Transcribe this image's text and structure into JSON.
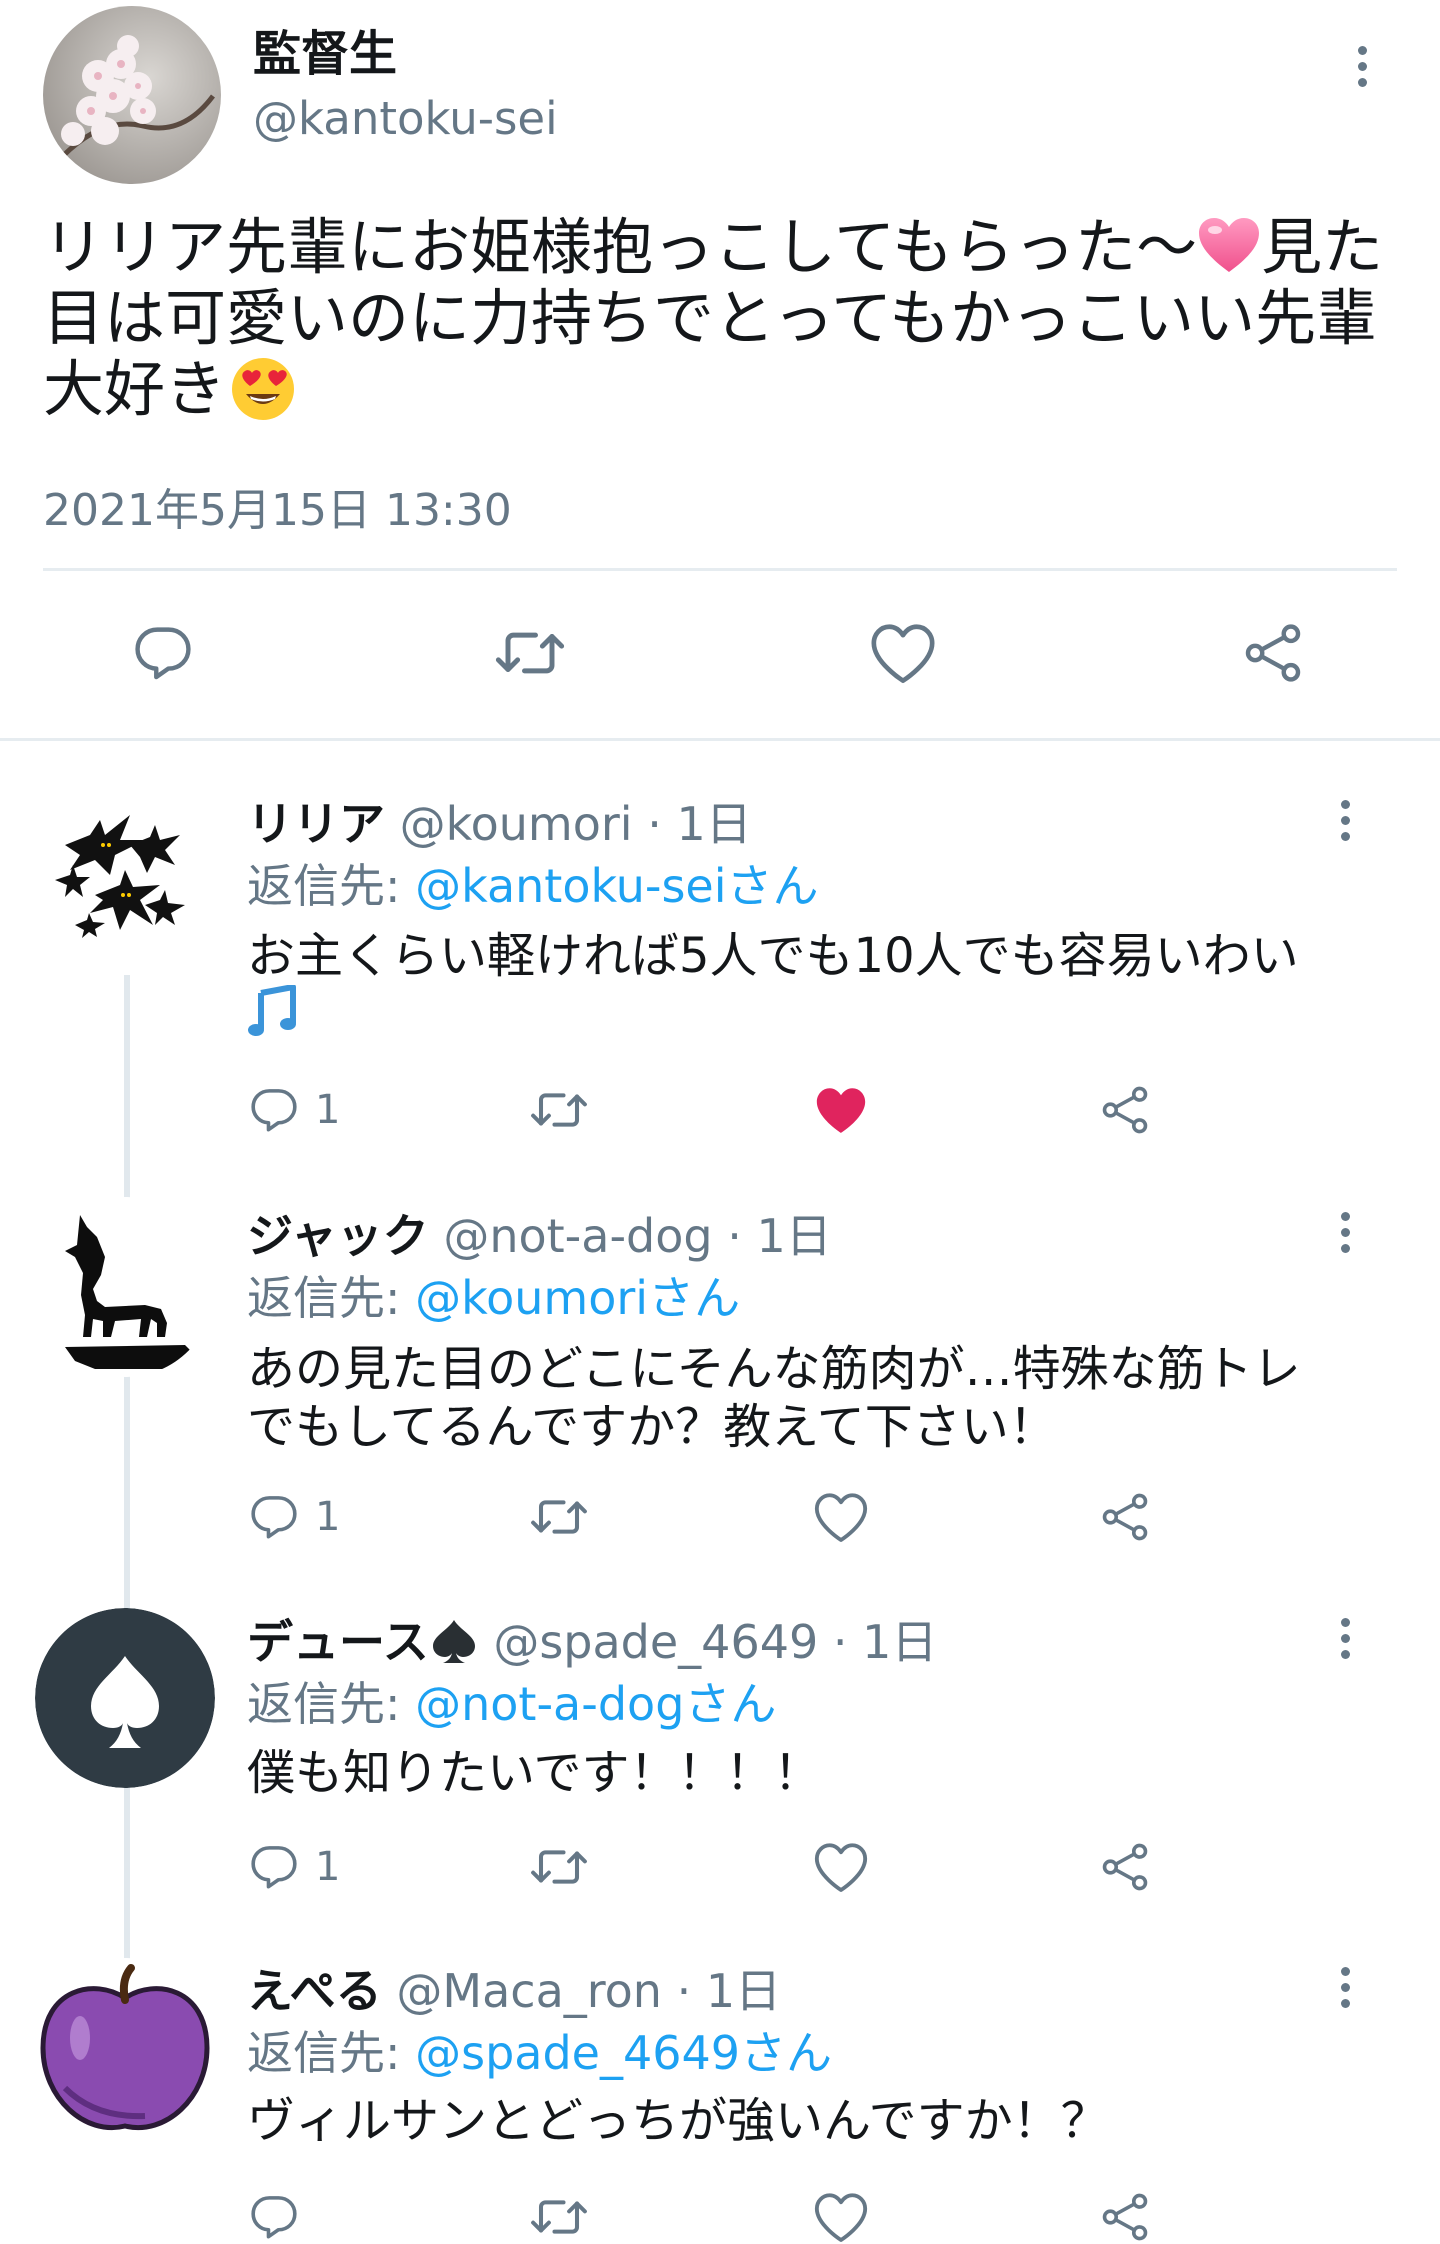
{
  "main_tweet": {
    "display_name": "監督生",
    "handle": "@kantoku-sei",
    "text_part1": "リリア先輩にお姫様抱っこしてもらった〜",
    "text_part2": "見た目は可愛いのに力持ちでとってもかっこいい先輩大好き",
    "emoji_1": "pink-heart",
    "emoji_2": "heart-eyes-face",
    "timestamp": "2021年5月15日 13:30",
    "actions": [
      "reply-icon",
      "retweet-icon",
      "like-icon",
      "share-icon"
    ]
  },
  "replies": [
    {
      "display_name": "リリア",
      "handle": "@koumori",
      "time": "· 1日",
      "reply_label": "返信先:",
      "reply_to": "@kantoku-seiさん",
      "text": "お主くらい軽ければ5人でも10人でも容易いわい",
      "trailing_emoji": "music-note",
      "reply_count": "1",
      "liked": true,
      "avatar": "bats-avatar"
    },
    {
      "display_name": "ジャック",
      "handle": "@not-a-dog",
      "time": "· 1日",
      "reply_label": "返信先:",
      "reply_to": "@koumoriさん",
      "text": "あの見た目のどこにそんな筋肉が…特殊な筋トレでもしてるんですか？教えて下さい！",
      "reply_count": "1",
      "liked": false,
      "avatar": "wolf-avatar"
    },
    {
      "display_name": "デュース",
      "name_emoji": "spade",
      "handle": "@spade_4649",
      "time": "· 1日",
      "reply_label": "返信先:",
      "reply_to": "@not-a-dogさん",
      "text": "僕も知りたいです！！！！",
      "reply_count": "1",
      "liked": false,
      "avatar": "spade-avatar"
    },
    {
      "display_name": "えぺる",
      "handle": "@Maca_ron",
      "time": "· 1日",
      "reply_label": "返信先:",
      "reply_to": "@spade_4649さん",
      "text": "ヴィルサンとどっちが強いんですか！？",
      "liked": false,
      "avatar": "purple-apple-avatar"
    }
  ],
  "colors": {
    "link": "#1da1f2",
    "like_active": "#e0245e",
    "secondary_text": "#657786"
  }
}
